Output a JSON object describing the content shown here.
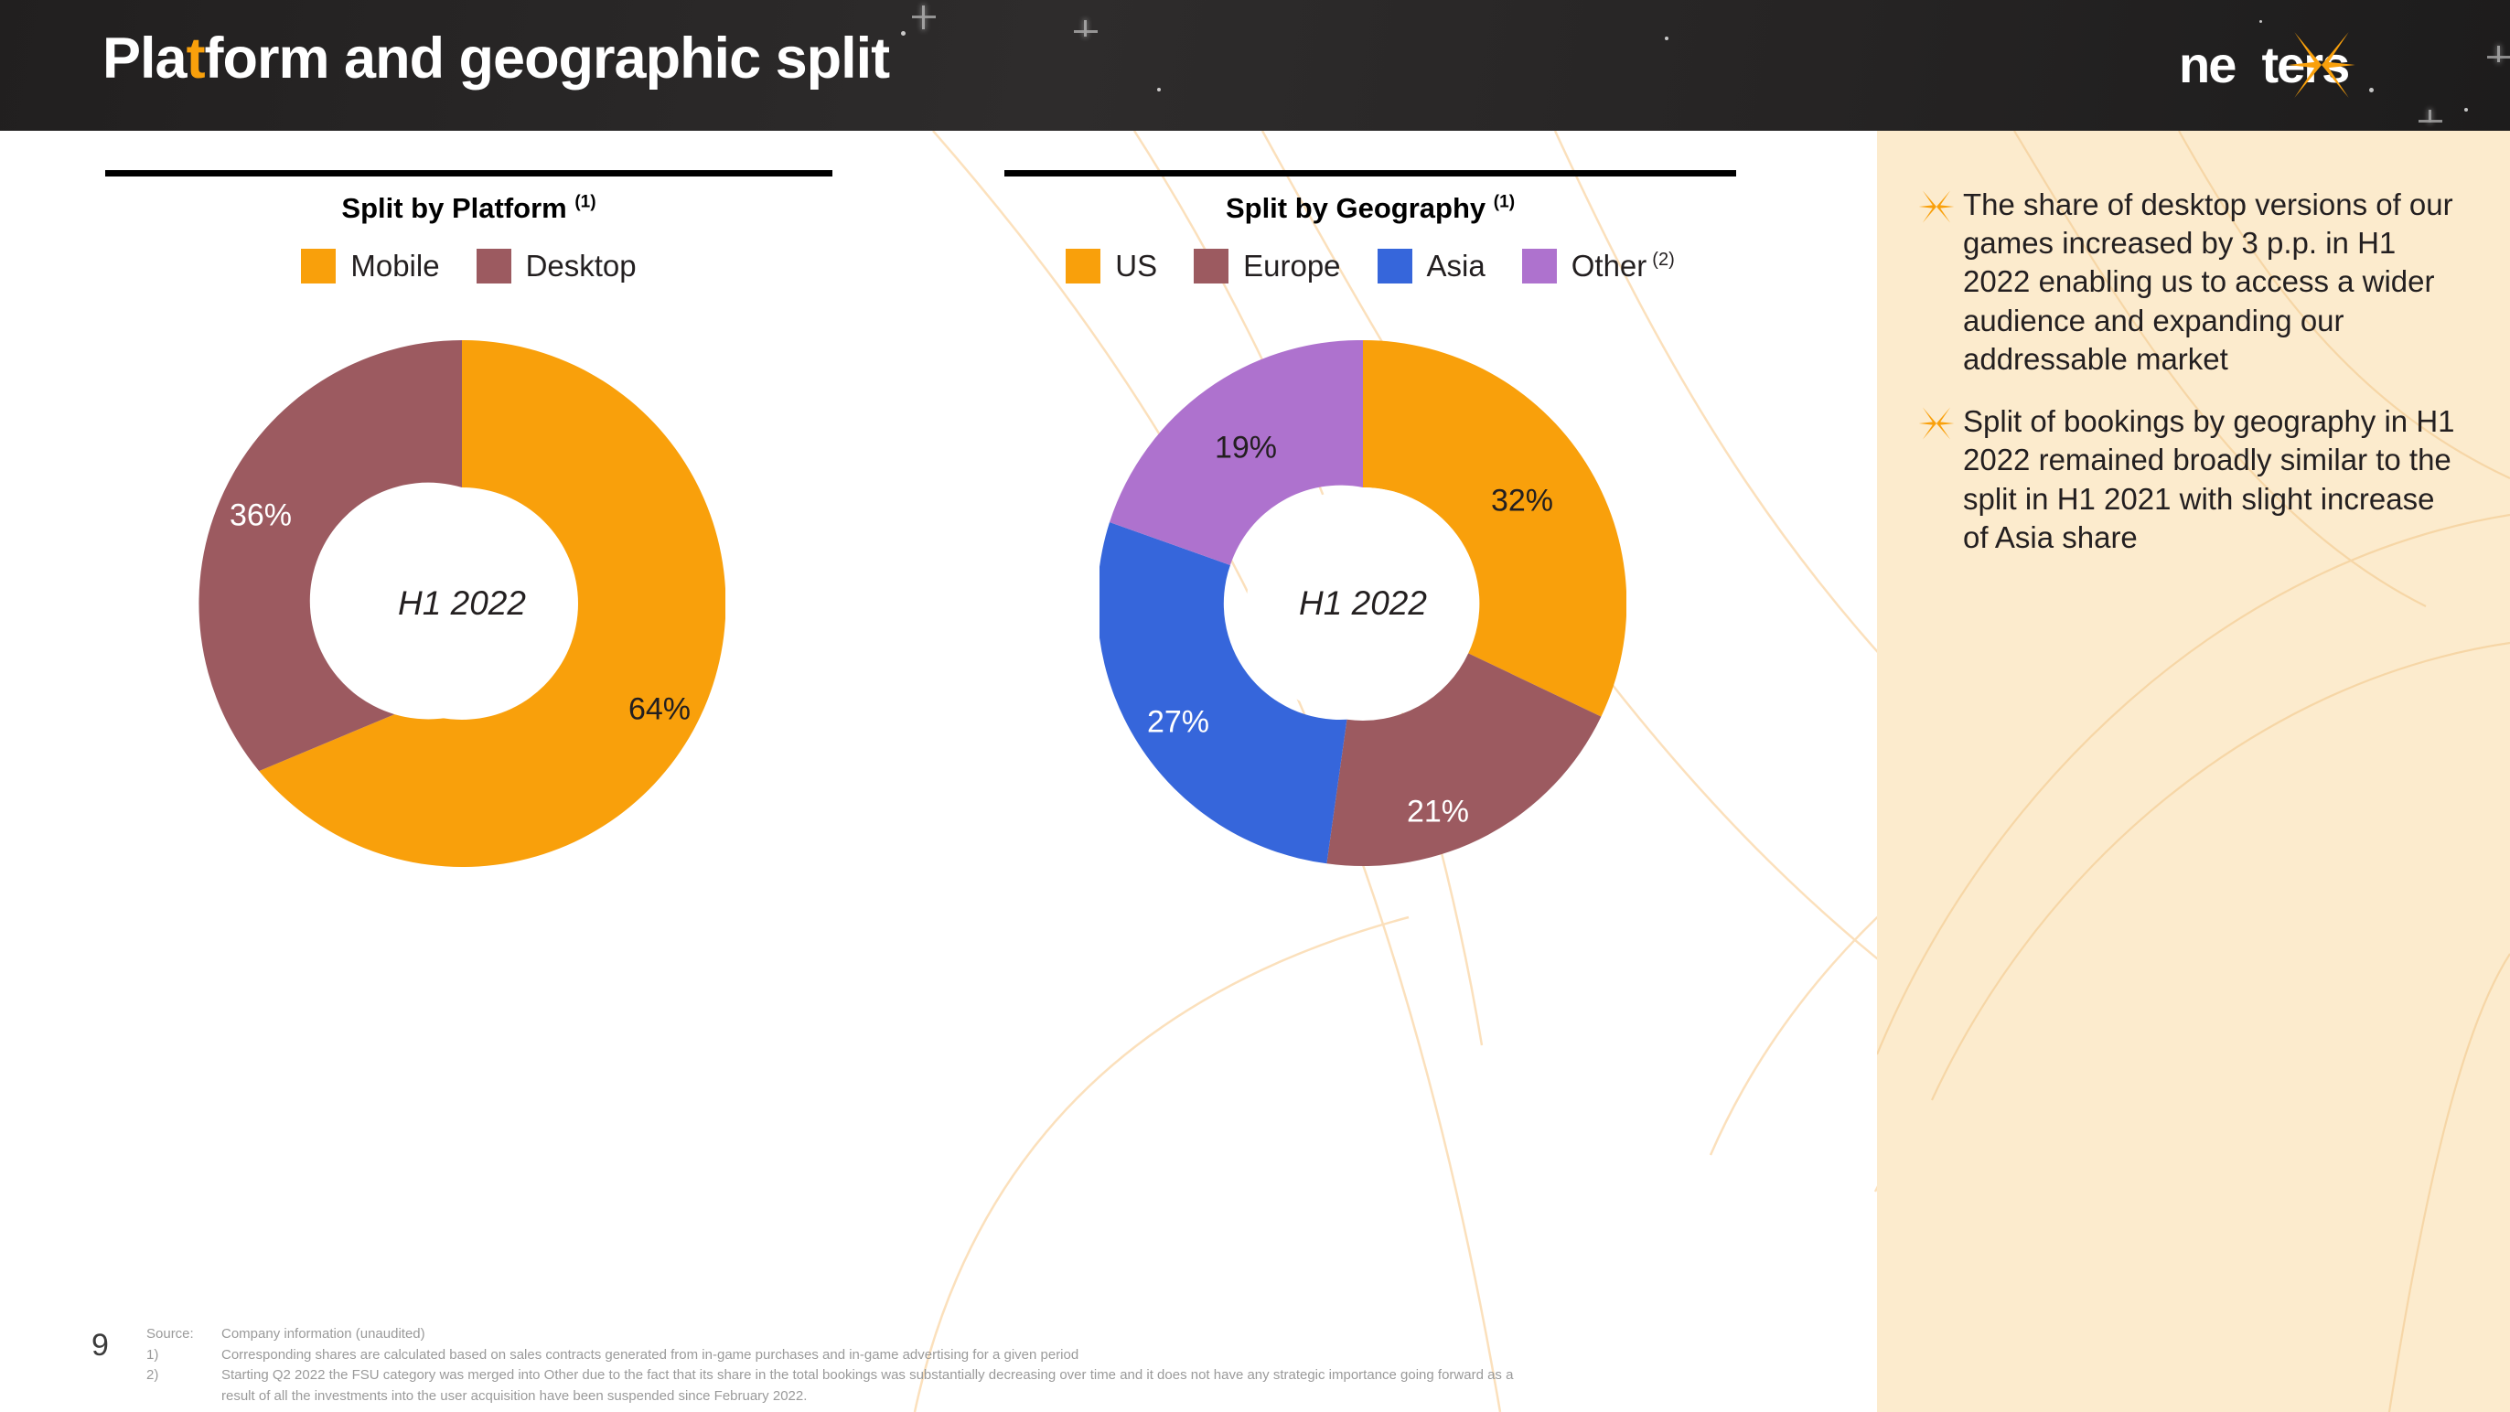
{
  "header": {
    "title_pre": "Pla",
    "title_accent": "t",
    "title_post": "form and geographic split",
    "title_full": "Platform and geographic split",
    "logo_pre": "ne",
    "logo_post": "ters",
    "logo_full": "nexters",
    "bar_color": "#2B2A2A",
    "accent_color": "#F9A00B"
  },
  "charts": [
    {
      "title": "Split by Platform",
      "title_sup": "(1)",
      "center_label": "H1 2022",
      "legend": [
        {
          "label": "Mobile",
          "sup": "",
          "color": "#F9A00B"
        },
        {
          "label": "Desktop",
          "sup": "",
          "color": "#9C5A60"
        }
      ]
    },
    {
      "title": "Split by Geography",
      "title_sup": "(1)",
      "center_label": "H1 2022",
      "legend": [
        {
          "label": "US",
          "sup": "",
          "color": "#F9A00B"
        },
        {
          "label": "Europe",
          "sup": "",
          "color": "#9C5A60"
        },
        {
          "label": "Asia",
          "sup": "",
          "color": "#3666DB"
        },
        {
          "label": "Other",
          "sup": "(2)",
          "color": "#AE72CE"
        }
      ]
    }
  ],
  "chart_data": [
    {
      "type": "pie",
      "title": "Split by Platform (1)",
      "subtitle": "H1 2022",
      "donut": true,
      "start_angle": 0,
      "direction": "clockwise",
      "categories": [
        "Mobile",
        "Desktop"
      ],
      "values": [
        64,
        36
      ],
      "labels": [
        "64%",
        "36%"
      ],
      "colors": [
        "#F9A00B",
        "#9C5A60"
      ],
      "label_colors": [
        "#231f20",
        "#ffffff"
      ],
      "unit": "%",
      "legend_position": "top"
    },
    {
      "type": "pie",
      "title": "Split by Geography (1)",
      "subtitle": "H1 2022",
      "donut": true,
      "start_angle": 0,
      "direction": "clockwise",
      "categories": [
        "US",
        "Europe",
        "Asia",
        "Other"
      ],
      "values": [
        32,
        21,
        27,
        19
      ],
      "labels": [
        "32%",
        "21%",
        "27%",
        "19%"
      ],
      "colors": [
        "#F9A00B",
        "#9C5A60",
        "#3666DB",
        "#AE72CE"
      ],
      "label_colors": [
        "#231f20",
        "#ffffff",
        "#ffffff",
        "#231f20"
      ],
      "unit": "%",
      "legend_position": "top"
    }
  ],
  "side_panel": {
    "background": "#FCEBCD",
    "bullets": [
      "The share of desktop versions of our games increased by 3 p.p. in H1 2022 enabling us to access a wider audience and expanding our addressable market",
      "Split of bookings by geography in H1 2022 remained broadly similar to the split in H1 2021 with slight increase of Asia share"
    ]
  },
  "footer": {
    "page_number": "9",
    "source_key": "Source:",
    "source_val": "Company information (unaudited)",
    "note1_key": "1)",
    "note1_val": "Corresponding shares are calculated based on sales contracts generated from in-game purchases  and in-game advertising for a given period",
    "note2_key": "2)",
    "note2_val": "Starting Q2 2022 the FSU category was merged into Other due to the fact that its share in the total bookings was substantially decreasing over time and it does not have any strategic importance going forward as a",
    "note2_cont": "result of all the investments into the user acquisition have been suspended since February 2022."
  }
}
